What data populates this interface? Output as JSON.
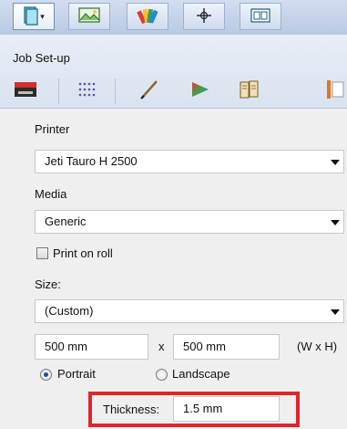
{
  "toolbar": {
    "buttons": [
      {
        "icon": "book-icon",
        "active": true,
        "has_dropdown": true
      },
      {
        "icon": "image-layout-icon"
      },
      {
        "icon": "color-swatches-icon"
      },
      {
        "icon": "crosshair-icon"
      },
      {
        "icon": "frame-layout-icon"
      }
    ]
  },
  "job_setup": {
    "title": "Job Set-up",
    "tabs": [
      {
        "icon": "printer-icon",
        "active": true
      },
      {
        "icon": "grid-icon"
      },
      {
        "icon": "pen-icon"
      },
      {
        "icon": "color-triangle-icon"
      },
      {
        "icon": "book-binding-icon"
      },
      {
        "icon": "document-icon"
      }
    ]
  },
  "form": {
    "printer_label": "Printer",
    "printer_value": "Jeti Tauro H 2500",
    "media_label": "Media",
    "media_value": "Generic",
    "print_on_roll_label": "Print on roll",
    "print_on_roll_checked": false,
    "size_label": "Size:",
    "size_value": "(Custom)",
    "width_value": "500 mm",
    "times_label": "x",
    "height_value": "500 mm",
    "wh_label": "(W x H)",
    "portrait_label": "Portrait",
    "landscape_label": "Landscape",
    "orientation": "Portrait",
    "thickness_label": "Thickness:",
    "thickness_value": "1.5 mm"
  },
  "colors": {
    "highlight": "#e0252b",
    "accent": "#1f4fa0"
  }
}
